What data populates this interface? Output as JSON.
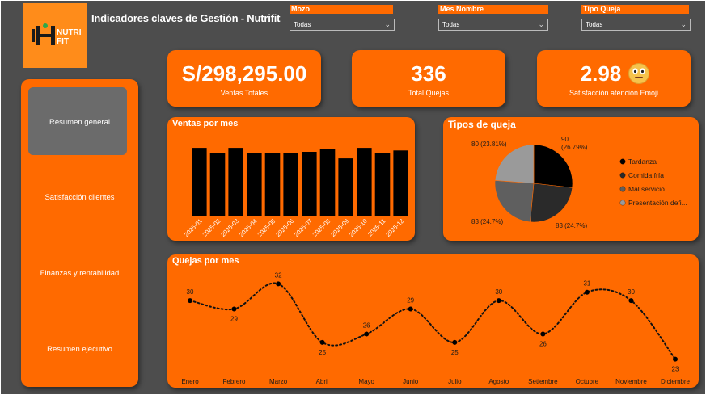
{
  "header": {
    "title": "Indicadores claves de Gestión - Nutrifit",
    "logo_text_line1": "NUTRI",
    "logo_text_line2": "FIT"
  },
  "slicers": [
    {
      "label": "Mozo",
      "value": "Todas"
    },
    {
      "label": "Mes Nombre",
      "value": "Todas"
    },
    {
      "label": "Tipo Queja",
      "value": "Todas"
    }
  ],
  "nav": {
    "items": [
      {
        "label": "Resumen general",
        "active": true
      },
      {
        "label": "Satisfacción clientes",
        "active": false
      },
      {
        "label": "Finanzas y rentabilidad",
        "active": false
      },
      {
        "label": "Resumen ejecutivo",
        "active": false
      }
    ]
  },
  "kpis": {
    "ventas": {
      "value": "S/298,295.00",
      "label": "Ventas Totales"
    },
    "quejas": {
      "value": "336",
      "label": "Total Quejas"
    },
    "satisfaccion": {
      "value": "2.98",
      "label": "Satisfacción atención Emoji",
      "icon": "neutral-face-emoji-icon"
    }
  },
  "colors": {
    "background": "#4d4d4d",
    "accent": "#ff6a00",
    "bar": "#000000"
  },
  "chart_data": [
    {
      "type": "bar",
      "title": "Ventas por mes",
      "categories": [
        "2025-01",
        "2025-02",
        "2025-03",
        "2025-04",
        "2025-05",
        "2025-06",
        "2025-07",
        "2025-08",
        "2025-09",
        "2025-10",
        "2025-11",
        "2025-12"
      ],
      "values": [
        26000,
        24000,
        26000,
        24000,
        24000,
        24000,
        24500,
        25500,
        22000,
        26000,
        24000,
        25000
      ],
      "ylim": [
        0,
        30000
      ],
      "grid": false
    },
    {
      "type": "pie",
      "title": "Tipos de queja",
      "slices": [
        {
          "name": "Tardanza",
          "value": 90,
          "label": "90\n(26.79%)",
          "color": "#000000"
        },
        {
          "name": "Comida fría",
          "value": 83,
          "label": "83 (24.7%)",
          "color": "#2a2a2a"
        },
        {
          "name": "Mal servicio",
          "value": 83,
          "label": "83 (24.7%)",
          "color": "#5f5f5f"
        },
        {
          "name": "Presentación defi...",
          "value": 80,
          "label": "80 (23.81%)",
          "color": "#9a9a9a"
        }
      ],
      "legend": "right"
    },
    {
      "type": "line",
      "title": "Quejas por mes",
      "categories": [
        "Enero",
        "Febrero",
        "Marzo",
        "Abril",
        "Mayo",
        "Junio",
        "Julio",
        "Agosto",
        "Setiembre",
        "Octubre",
        "Noviembre",
        "Diciembre"
      ],
      "values": [
        30,
        29,
        32,
        25,
        26,
        29,
        25,
        30,
        26,
        31,
        30,
        23
      ],
      "ylim": [
        22,
        33
      ],
      "style": "dotted"
    }
  ]
}
